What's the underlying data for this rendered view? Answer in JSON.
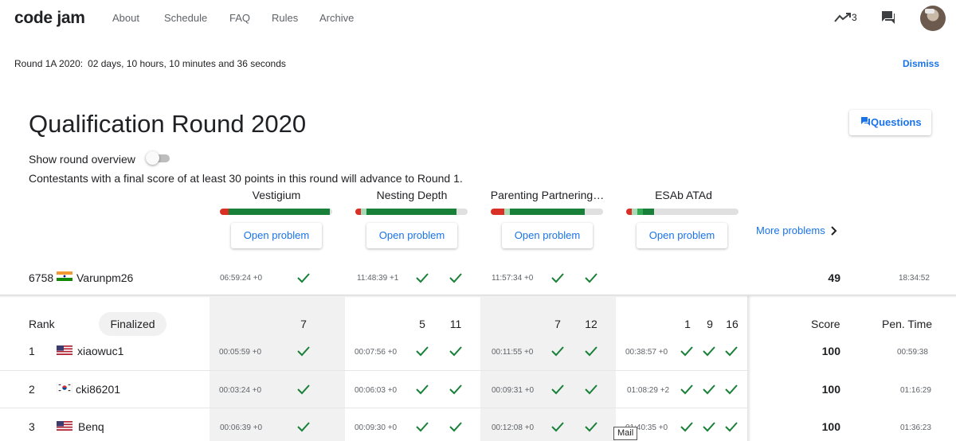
{
  "nav": {
    "logo": "code jam",
    "links": [
      "About",
      "Schedule",
      "FAQ",
      "Rules",
      "Archive"
    ],
    "notification_count": "3"
  },
  "banner": {
    "label": "Round 1A 2020:",
    "countdown": "02 days, 10 hours, 10 minutes and 36 seconds",
    "dismiss": "Dismiss"
  },
  "round": {
    "title": "Qualification Round 2020",
    "questions_button": "Questions",
    "overview_label": "Show round overview",
    "overview_on": false,
    "advance_text": "Contestants with a final score of at least 30 points in this round will advance to Round 1."
  },
  "problems": [
    {
      "name": "Vestigium",
      "open_label": "Open problem",
      "bar": [
        {
          "color": "#d93025",
          "frac": 0.08
        },
        {
          "color": "#188038",
          "frac": 0.9
        }
      ]
    },
    {
      "name": "Nesting Depth",
      "open_label": "Open problem",
      "bar": [
        {
          "color": "#d93025",
          "frac": 0.05
        },
        {
          "color": "#a8dab5",
          "frac": 0.05
        },
        {
          "color": "#188038",
          "frac": 0.8
        }
      ]
    },
    {
      "name": "Parenting Partnering…",
      "open_label": "Open problem",
      "bar": [
        {
          "color": "#d93025",
          "frac": 0.12
        },
        {
          "color": "#a8dab5",
          "frac": 0.05
        },
        {
          "color": "#188038",
          "frac": 0.67
        }
      ]
    },
    {
      "name": "ESAb ATAd",
      "open_label": "Open problem",
      "bar": [
        {
          "color": "#d93025",
          "frac": 0.05
        },
        {
          "color": "#a8dab5",
          "frac": 0.05
        },
        {
          "color": "#34a853",
          "frac": 0.05
        },
        {
          "color": "#188038",
          "frac": 0.1
        }
      ]
    }
  ],
  "more_problems": "More problems",
  "my_row": {
    "rank": "6758",
    "flag": "IN",
    "name": "Varunpm26",
    "times": [
      "06:59:24 +0",
      "11:48:39 +1",
      "11:57:34 +0"
    ],
    "score": "49",
    "penalty": "18:34:52"
  },
  "table": {
    "rank_label": "Rank",
    "filter_label": "Finalized",
    "score_label": "Score",
    "penalty_label": "Pen. Time",
    "points": [
      [
        "7"
      ],
      [
        "5",
        "11"
      ],
      [
        "7",
        "12"
      ],
      [
        "1",
        "9",
        "16"
      ]
    ],
    "rows": [
      {
        "rank": "1",
        "flag": "US",
        "name": "xiaowuc1",
        "times": [
          "00:05:59 +0",
          "00:07:56 +0",
          "00:11:55 +0",
          "00:38:57 +0"
        ],
        "score": "100",
        "penalty": "00:59:38"
      },
      {
        "rank": "2",
        "flag": "KR",
        "name": "cki86201",
        "times": [
          "00:03:24 +0",
          "00:06:03 +0",
          "00:09:31 +0",
          "01:08:29 +2"
        ],
        "score": "100",
        "penalty": "01:16:29"
      },
      {
        "rank": "3",
        "flag": "US",
        "name": "Benq",
        "times": [
          "00:06:39 +0",
          "00:09:30 +0",
          "00:12:08 +0",
          "01:40:35 +0"
        ],
        "score": "100",
        "penalty": "01:36:23"
      }
    ]
  },
  "tooltip": "Mail",
  "colors": {
    "accent": "#1a73e8",
    "check": "#188038"
  }
}
